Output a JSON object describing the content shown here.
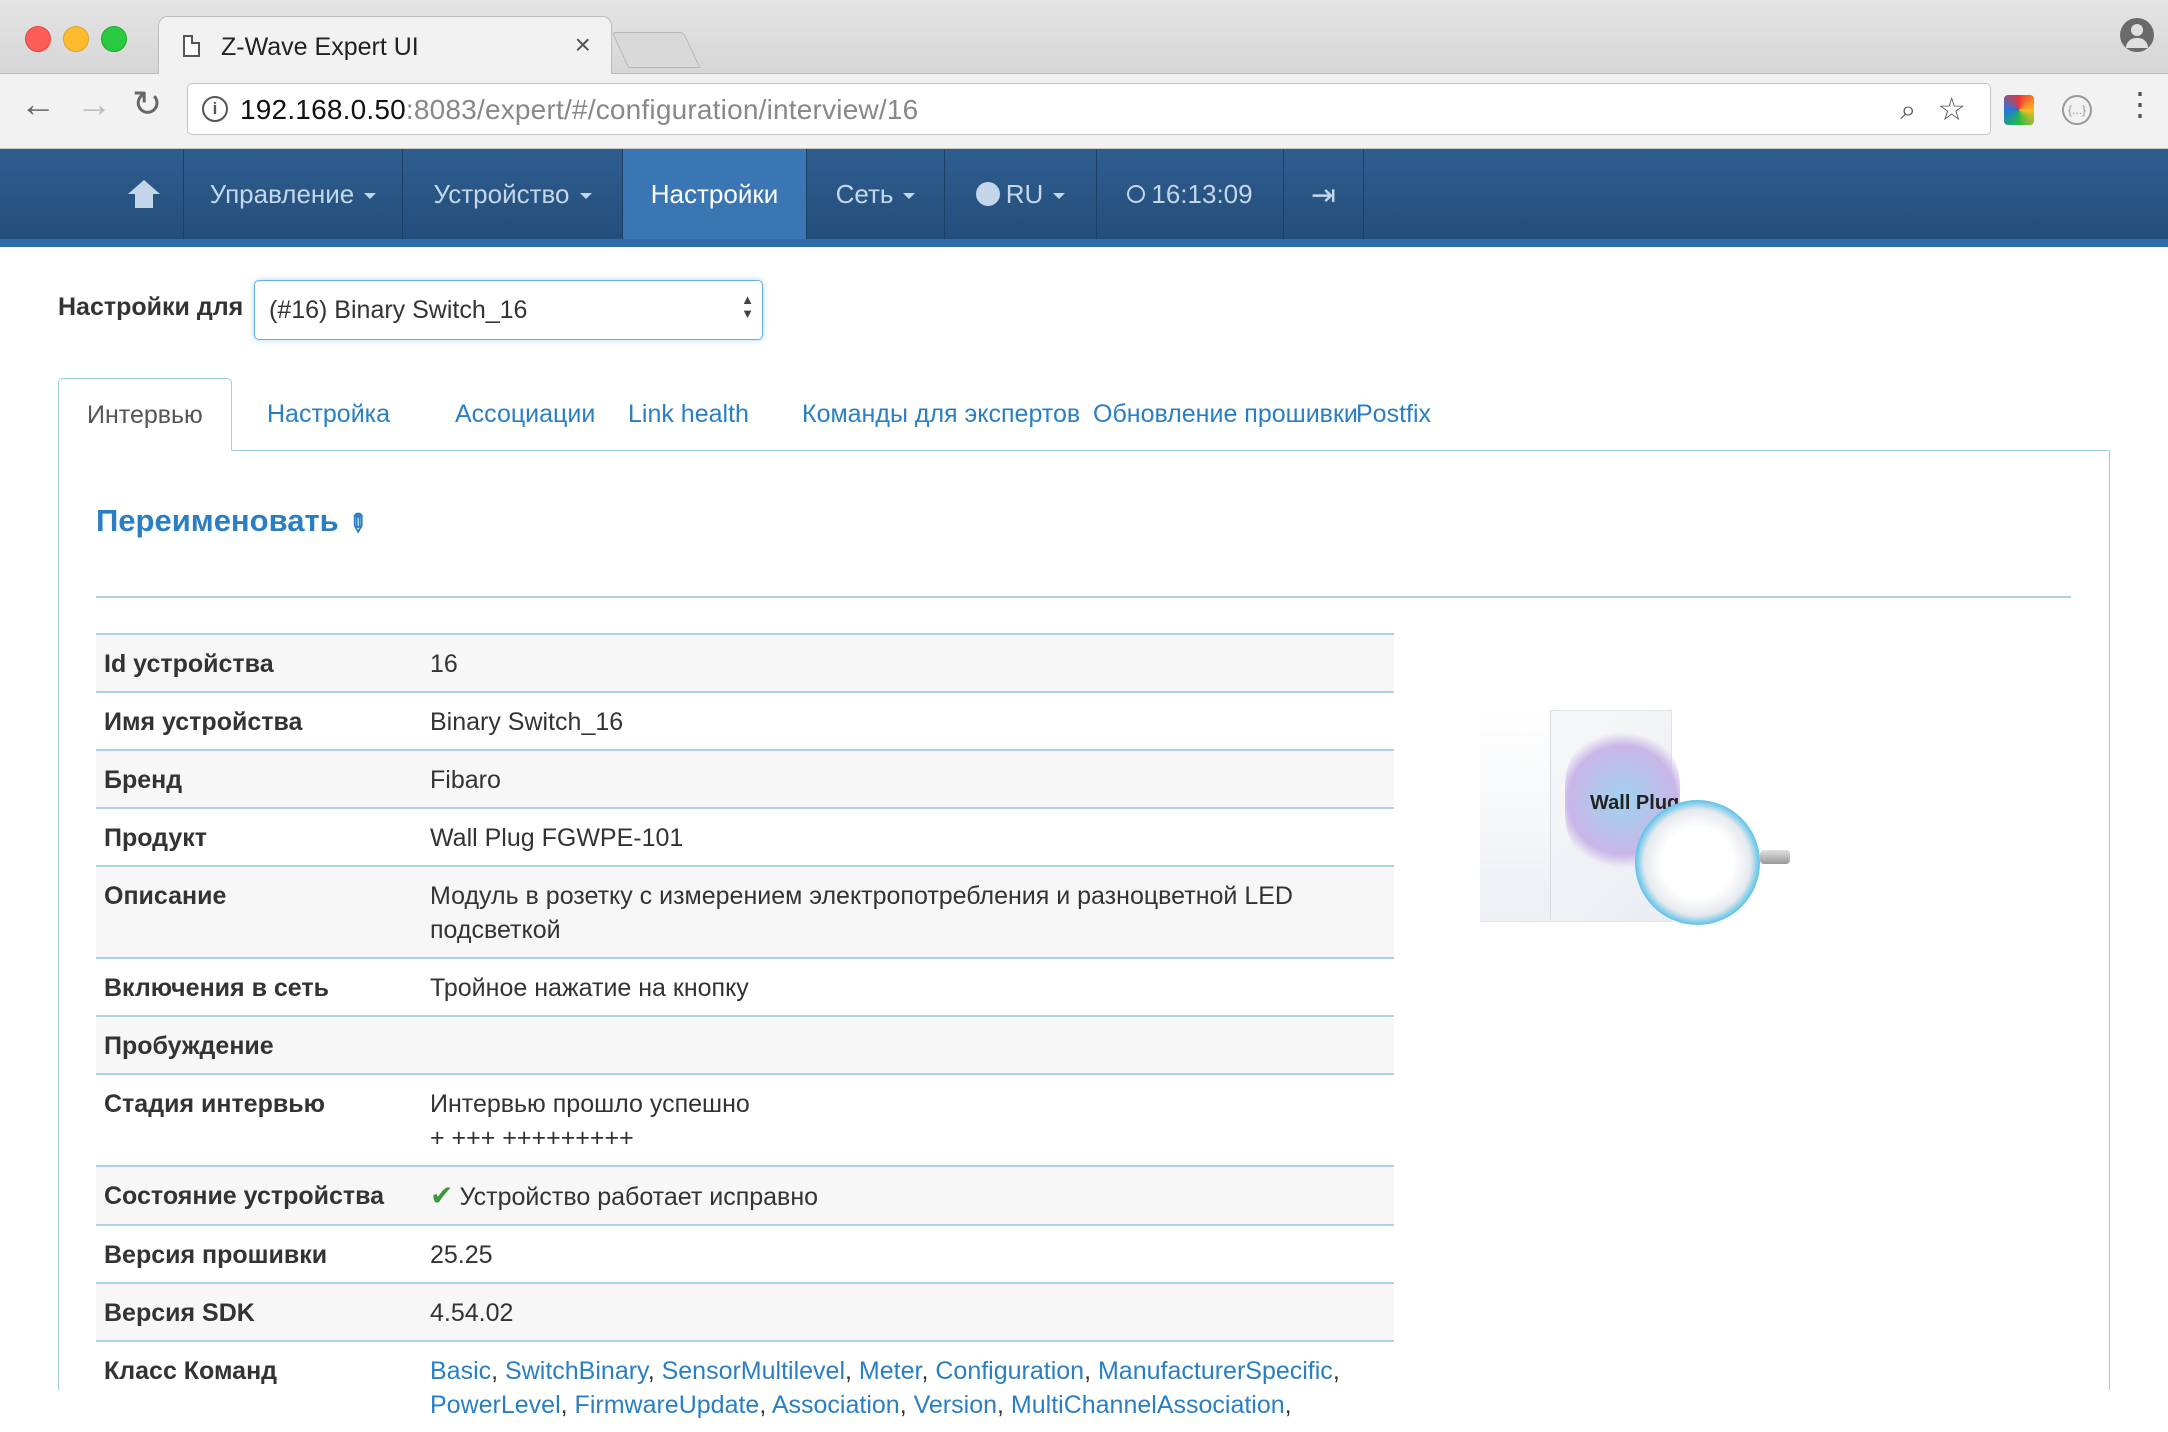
{
  "browser": {
    "tab_title": "Z-Wave Expert UI",
    "url_host": "192.168.0.50",
    "url_rest": ":8083/expert/#/configuration/interview/16"
  },
  "appnav": {
    "items": [
      {
        "label": "Управление"
      },
      {
        "label": "Устройство"
      },
      {
        "label": "Настройки"
      },
      {
        "label": "Сеть"
      },
      {
        "label": "RU"
      },
      {
        "label": "16:13:09"
      }
    ]
  },
  "config": {
    "label": "Настройки для",
    "selected": "(#16) Binary Switch_16"
  },
  "tabs": [
    "Интервью",
    "Настройка",
    "Ассоциации",
    "Link health",
    "Команды для экспертов",
    "Обновление прошивки",
    "Postfix"
  ],
  "rename_label": "Переименовать",
  "rows": {
    "id": {
      "k": "Id устройства",
      "v": "16"
    },
    "name": {
      "k": "Имя устройства",
      "v": "Binary Switch_16"
    },
    "brand": {
      "k": "Бренд",
      "v": "Fibaro"
    },
    "product": {
      "k": "Продукт",
      "v": "Wall Plug FGWPE-101"
    },
    "description": {
      "k": "Описание",
      "v": "Модуль в розетку с измерением электропотребления и разноцветной LED подсветкой"
    },
    "inclusion": {
      "k": "Включения в сеть",
      "v": "Тройное нажатие на кнопку"
    },
    "wakeup": {
      "k": "Пробуждение",
      "v": ""
    },
    "interview": {
      "k": "Стадия интервью",
      "v": "Интервью прошло успешно",
      "v2": "+ +++ +++++++++"
    },
    "state": {
      "k": "Состояние устройства",
      "v": "Устройство работает исправно"
    },
    "firmware": {
      "k": "Версия прошивки",
      "v": "25.25"
    },
    "sdk": {
      "k": "Версия SDK",
      "v": "4.54.02"
    },
    "classes": {
      "k": "Класс Команд",
      "list": [
        "Basic",
        "SwitchBinary",
        "SensorMultilevel",
        "Meter",
        "Configuration",
        "ManufacturerSpecific",
        "PowerLevel",
        "FirmwareUpdate",
        "Association",
        "Version",
        "MultiChannelAssociation"
      ]
    }
  },
  "product_image": {
    "label": "Wall Plug"
  },
  "colors": {
    "nav_bg": "#244e7b",
    "nav_active": "#3a76b3",
    "link": "#2a7fc4",
    "rule": "#aad3ea"
  }
}
